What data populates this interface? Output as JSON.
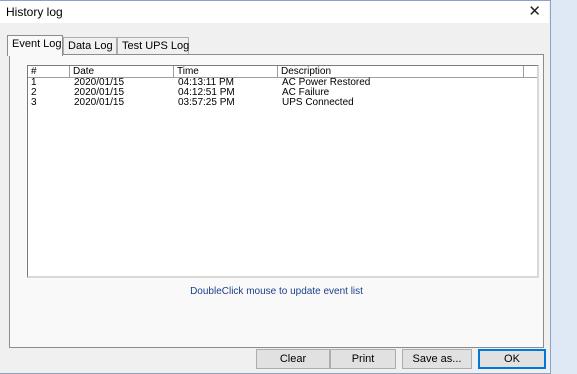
{
  "window": {
    "title": "History log"
  },
  "tabs": [
    {
      "label": "Event Log"
    },
    {
      "label": "Data Log"
    },
    {
      "label": "Test UPS Log"
    }
  ],
  "table": {
    "columns": [
      "#",
      "Date",
      "Time",
      "Description"
    ],
    "rows": [
      [
        "1",
        "2020/01/15",
        "04:13:11 PM",
        "AC Power Restored"
      ],
      [
        "2",
        "2020/01/15",
        "04:12:51 PM",
        "AC Failure"
      ],
      [
        "3",
        "2020/01/15",
        "03:57:25 PM",
        "UPS Connected"
      ]
    ]
  },
  "hint": "DoubleClick mouse to update event list",
  "buttons": {
    "clear": "Clear",
    "print": "Print",
    "save_as": "Save as...",
    "ok": "OK"
  },
  "icons": {
    "close": "close-icon"
  }
}
